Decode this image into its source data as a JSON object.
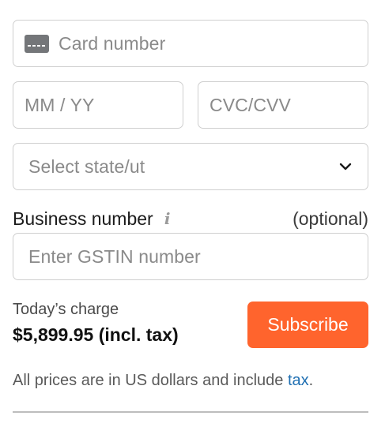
{
  "card": {
    "placeholder": "Card number",
    "icon": "credit-card-icon"
  },
  "expiry": {
    "placeholder": "MM / YY"
  },
  "cvc": {
    "placeholder": "CVC/CVV"
  },
  "state": {
    "placeholder": "Select state/ut",
    "icon": "chevron-down-icon"
  },
  "business": {
    "label": "Business number",
    "info_icon": "info-icon",
    "optional": "(optional)",
    "placeholder": "Enter GSTIN number"
  },
  "charge": {
    "label": "Today’s charge",
    "amount": "$5,899.95 (incl. tax)"
  },
  "subscribe": {
    "label": "Subscribe",
    "color": "#ff642d"
  },
  "footnote": {
    "text": "All prices are in US dollars and include ",
    "link": "tax",
    "end": ".",
    "link_color": "#1f6fb2"
  }
}
